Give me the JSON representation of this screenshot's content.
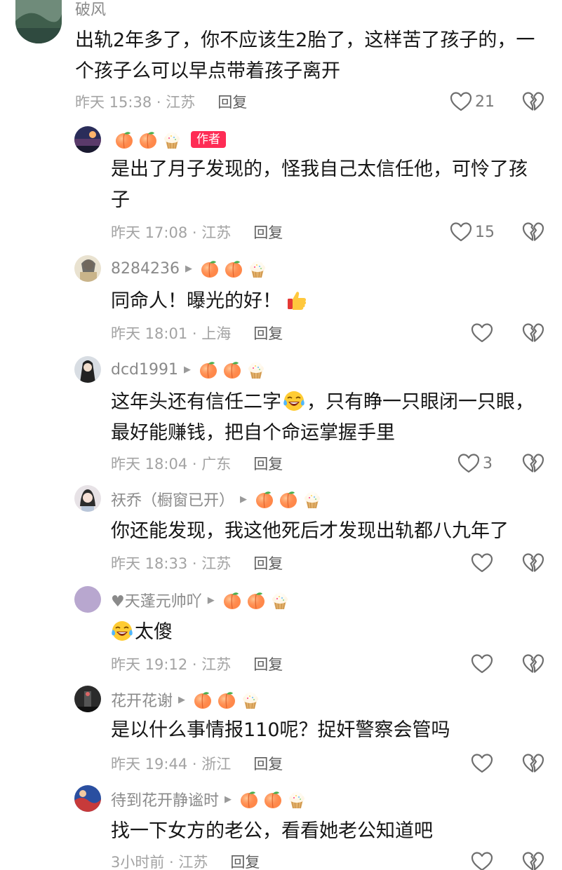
{
  "comments": [
    {
      "user": "破风",
      "text": "出轨2年多了，你不应该生2胎了，这样苦了孩子的，一个孩子么可以早点带着孩子离开",
      "time": "昨天 15:38 · 江苏",
      "reply": "回复",
      "likes": "21"
    },
    {
      "user": "",
      "author_tag": "作者",
      "text": "是出了月子发现的，怪我自己太信任他，可怜了孩子",
      "time": "昨天 17:08 · 江苏",
      "reply": "回复",
      "likes": "15"
    },
    {
      "user": "8284236",
      "text": "同命人！曝光的好！",
      "time": "昨天 18:01 · 上海",
      "reply": "回复",
      "likes": ""
    },
    {
      "user": "dcd1991",
      "text_a": "这年头还有信任二字",
      "text_b": "，只有睁一只眼闭一只眼，最好能赚钱，把自个命运掌握手里",
      "time": "昨天 18:04 · 广东",
      "reply": "回复",
      "likes": "3"
    },
    {
      "user": "祆乔（橱窗已开）",
      "text": "你还能发现，我这他死后才发现出轨都八九年了",
      "time": "昨天 18:33 · 江苏",
      "reply": "回复",
      "likes": ""
    },
    {
      "user": "♥天蓬元帅吖",
      "text": "太傻",
      "time": "昨天 19:12 · 江苏",
      "reply": "回复",
      "likes": ""
    },
    {
      "user": "花开花谢",
      "text": "是以什么事情报110呢？捉奸警察会管吗",
      "time": "昨天 19:44 · 浙江",
      "reply": "回复",
      "likes": ""
    },
    {
      "user": "待到花开静谧时",
      "text": "找一下女方的老公，看看她老公知道吧",
      "time": "3小时前 · 江苏",
      "reply": "回复",
      "likes": ""
    }
  ],
  "icons": {
    "like": "heart-outline-icon",
    "dislike": "broken-heart-icon",
    "badge_peach": "peach-icon",
    "badge_cake": "cupcake-icon"
  },
  "colors": {
    "author_tag": "#fe2c55",
    "meta": "#a3a3a3",
    "username": "#8a8a8a"
  }
}
